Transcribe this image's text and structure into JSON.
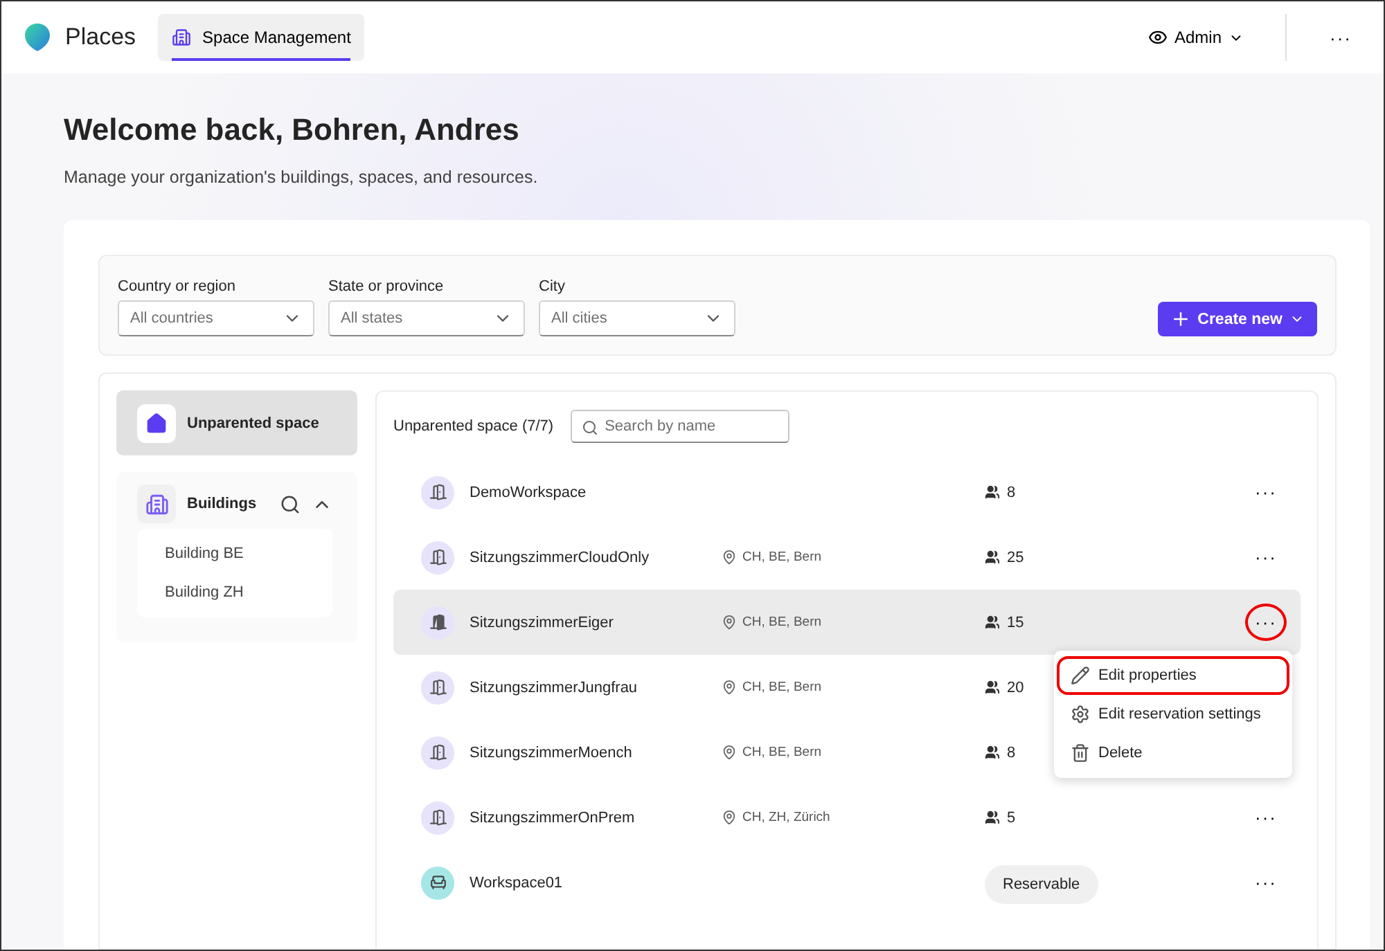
{
  "app": {
    "name": "Places"
  },
  "nav_tabs": [
    {
      "label": "Space Management",
      "selected": true
    }
  ],
  "user_menu": {
    "label": "Admin"
  },
  "header_more": "···",
  "welcome": {
    "title": "Welcome back, Bohren, Andres",
    "subtitle": "Manage your organization's buildings, spaces, and resources."
  },
  "filters": [
    {
      "label": "Country or region",
      "placeholder": "All countries"
    },
    {
      "label": "State or province",
      "placeholder": "All states"
    },
    {
      "label": "City",
      "placeholder": "All cities"
    }
  ],
  "create_button": {
    "label": "Create new"
  },
  "sidebar": {
    "items": [
      {
        "label": "Unparented space",
        "selected": true
      }
    ],
    "buildings": {
      "label": "Buildings",
      "expanded": true,
      "children": [
        {
          "label": "Building BE"
        },
        {
          "label": "Building ZH"
        }
      ]
    }
  },
  "list": {
    "heading": "Unparented space (7/7)",
    "search": {
      "placeholder": "Search by name"
    },
    "rows": [
      {
        "kind": "room",
        "name": "DemoWorkspace",
        "capacity": "8",
        "selected": false,
        "menu_open": false
      },
      {
        "kind": "room",
        "name": "SitzungszimmerCloudOnly",
        "location": "CH, BE, Bern",
        "capacity": "25",
        "selected": false,
        "menu_open": false
      },
      {
        "kind": "room",
        "name": "SitzungszimmerEiger",
        "location": "CH, BE, Bern",
        "capacity": "15",
        "selected": true,
        "menu_open": true
      },
      {
        "kind": "room",
        "name": "SitzungszimmerJungfrau",
        "location": "CH, BE, Bern",
        "capacity": "20",
        "selected": false,
        "menu_open": false
      },
      {
        "kind": "room",
        "name": "SitzungszimmerMoench",
        "location": "CH, BE, Bern",
        "capacity": "8",
        "selected": false,
        "menu_open": false
      },
      {
        "kind": "room",
        "name": "SitzungszimmerOnPrem",
        "location": "CH, ZH, Zürich",
        "capacity": "5",
        "selected": false,
        "menu_open": false
      },
      {
        "kind": "workspace",
        "name": "Workspace01",
        "tag": "Reservable",
        "selected": false,
        "menu_open": false
      }
    ],
    "more_label": "···",
    "context_menu": [
      {
        "kind": "edit",
        "label": "Edit properties",
        "highlighted": true
      },
      {
        "kind": "settings",
        "label": "Edit reservation settings",
        "highlighted": false
      },
      {
        "kind": "delete",
        "label": "Delete",
        "highlighted": false
      }
    ]
  }
}
